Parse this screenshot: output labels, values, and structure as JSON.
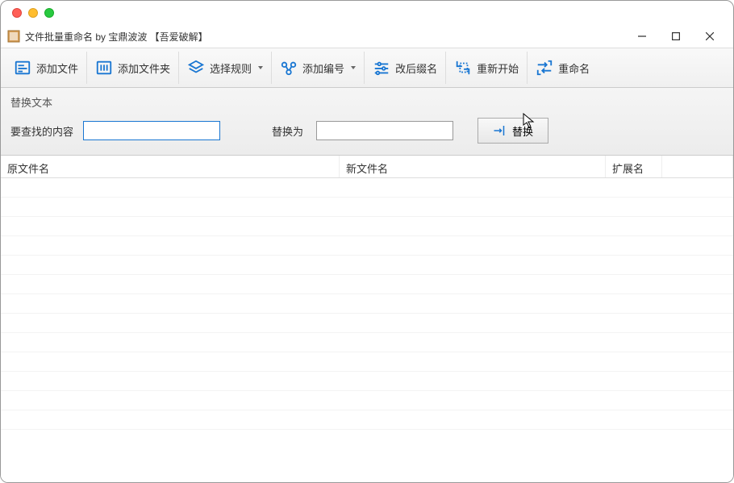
{
  "titlebar": {
    "app_title": "文件批量重命名 by 宝鼎波波 【吾爱破解】"
  },
  "toolbar": {
    "add_file": "添加文件",
    "add_folder": "添加文件夹",
    "select_rule": "选择规则",
    "add_number": "添加编号",
    "change_ext": "改后缀名",
    "restart": "重新开始",
    "rename": "重命名"
  },
  "replace_panel": {
    "section_title": "替换文本",
    "find_label": "要查找的内容",
    "find_value": "",
    "replace_label": "替换为",
    "replace_value": "",
    "replace_button": "替换"
  },
  "table": {
    "columns": {
      "original": "原文件名",
      "new": "新文件名",
      "ext": "扩展名"
    },
    "rows": []
  },
  "colors": {
    "accent": "#1976d2"
  }
}
